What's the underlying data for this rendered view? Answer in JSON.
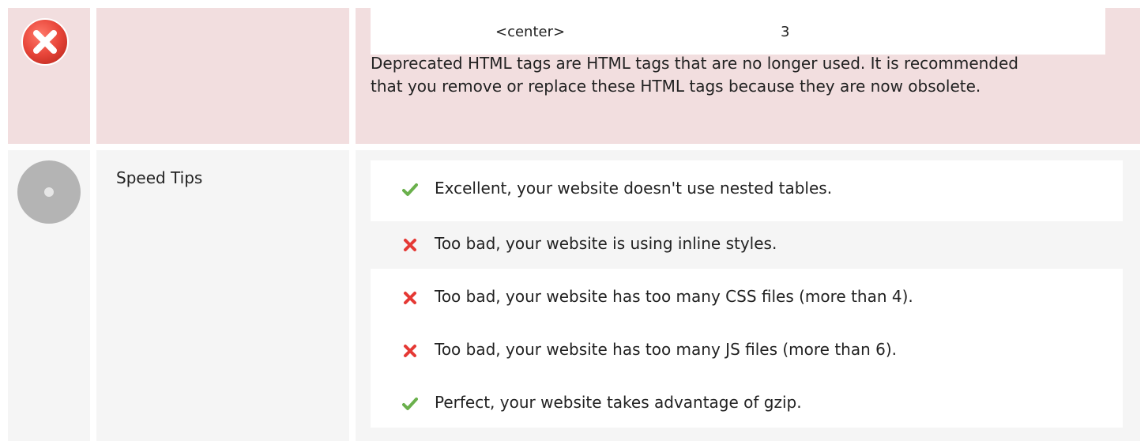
{
  "deprecated": {
    "tag": "<center>",
    "count": "3",
    "description": "Deprecated HTML tags are HTML tags that are no longer used. It is recommended that you remove or replace these HTML tags because they are now obsolete.",
    "status_icon": "error-x-icon",
    "status_color": "#e53935"
  },
  "speed_tips": {
    "title": "Speed Tips",
    "status_icon": "neutral-circle-icon",
    "items": [
      {
        "icon": "check-icon",
        "color": "#6ab04c",
        "text": "Excellent, your website doesn't use nested tables."
      },
      {
        "icon": "cross-icon",
        "color": "#e53935",
        "text": "Too bad, your website is using inline styles."
      },
      {
        "icon": "cross-icon",
        "color": "#e53935",
        "text": "Too bad, your website has too many CSS files (more than 4)."
      },
      {
        "icon": "cross-icon",
        "color": "#e53935",
        "text": "Too bad, your website has too many JS files (more than 6)."
      },
      {
        "icon": "check-icon",
        "color": "#6ab04c",
        "text": "Perfect, your website takes advantage of gzip."
      }
    ]
  },
  "colors": {
    "error_row_bg": "#f2dedf",
    "neutral_row_bg": "#f5f5f5"
  }
}
